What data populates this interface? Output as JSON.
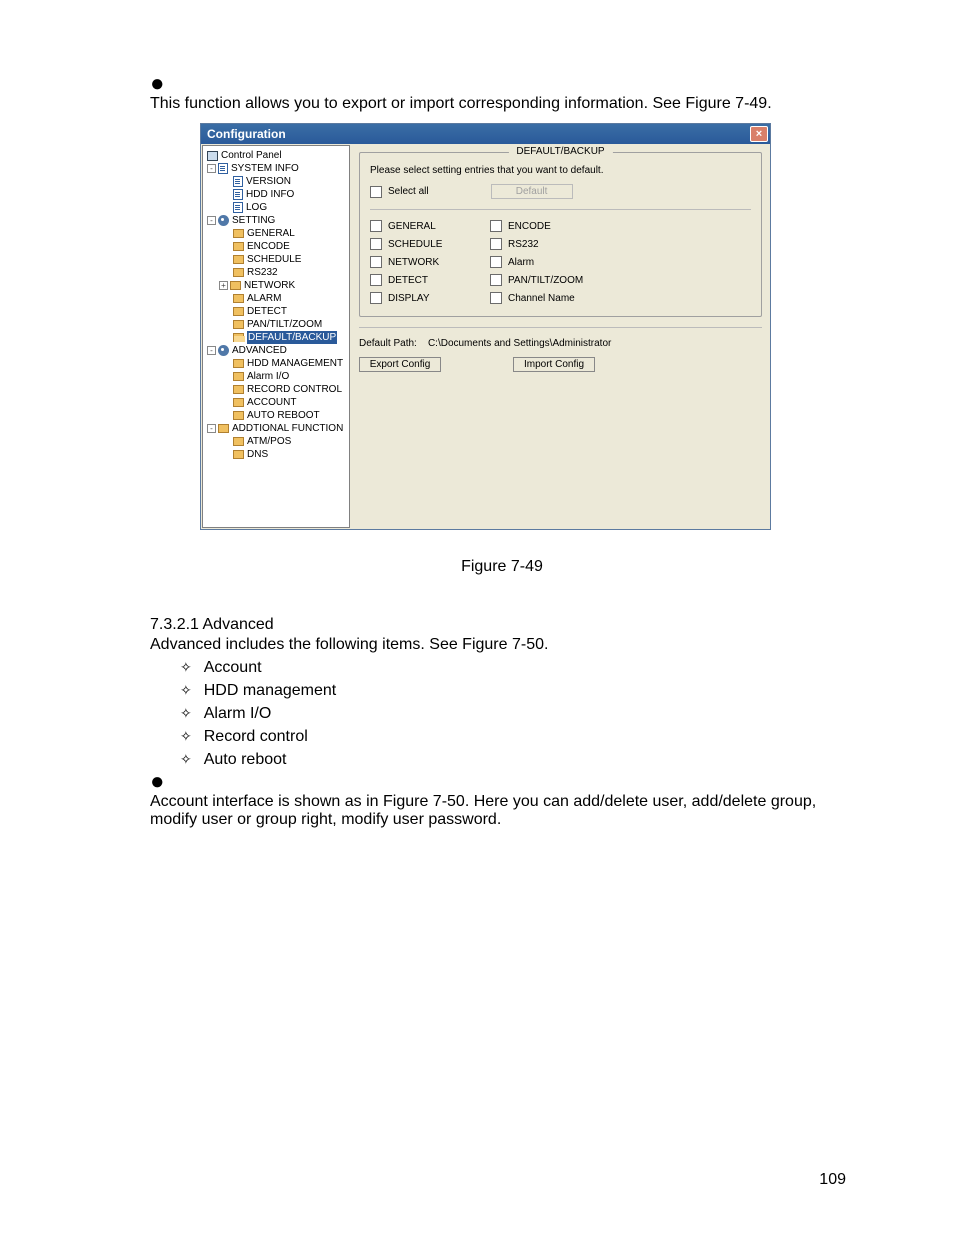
{
  "intro_line": "This function allows you to export or import corresponding information. See Figure 7-49.",
  "window": {
    "title": "Configuration",
    "tree": {
      "root": "Control Panel",
      "system_info": {
        "label": "SYSTEM INFO",
        "children": {
          "version": "VERSION",
          "hdd": "HDD INFO",
          "log": "LOG"
        }
      },
      "setting": {
        "label": "SETTING",
        "children": {
          "general": "GENERAL",
          "encode": "ENCODE",
          "schedule": "SCHEDULE",
          "rs232": "RS232",
          "network": "NETWORK",
          "alarm": "ALARM",
          "detect": "DETECT",
          "ptz": "PAN/TILT/ZOOM",
          "default_backup": "DEFAULT/BACKUP"
        }
      },
      "advanced": {
        "label": "ADVANCED",
        "children": {
          "hdd_mgmt": "HDD MANAGEMENT",
          "alarm_io": "Alarm I/O",
          "record_ctrl": "RECORD CONTROL",
          "account": "ACCOUNT",
          "auto_reboot": "AUTO REBOOT"
        }
      },
      "addl": {
        "label": "ADDTIONAL FUNCTION",
        "children": {
          "atm_pos": "ATM/POS",
          "dns": "DNS"
        }
      }
    },
    "panel": {
      "group_legend": "DEFAULT/BACKUP",
      "instruction": "Please select setting entries that you want to default.",
      "select_all_label": "Select all",
      "default_btn": "Default",
      "checks": {
        "general": "GENERAL",
        "encode": "ENCODE",
        "schedule": "SCHEDULE",
        "rs232": "RS232",
        "network": "NETWORK",
        "alarm": "Alarm",
        "detect": "DETECT",
        "ptz": "PAN/TILT/ZOOM",
        "display": "DISPLAY",
        "channel_name": "Channel Name"
      },
      "path_label": "Default Path:",
      "path_value": "C:\\Documents and Settings\\Administrator",
      "export_btn": "Export Config",
      "import_btn": "Import Config"
    }
  },
  "figure_caption": "Figure 7-49",
  "advanced_section": {
    "heading": "7.3.2.1  Advanced",
    "intro": "Advanced includes the following items. See Figure 7-50.",
    "items": {
      "account": "Account",
      "hdd": "HDD management",
      "alarm_io": "Alarm I/O",
      "record_ctrl": "Record control",
      "auto_reboot": "Auto reboot"
    },
    "paragraph": "Account interface is shown as in Figure 7-50. Here you can add/delete user, add/delete group, modify user or group right, modify user password."
  },
  "page_number": "109"
}
